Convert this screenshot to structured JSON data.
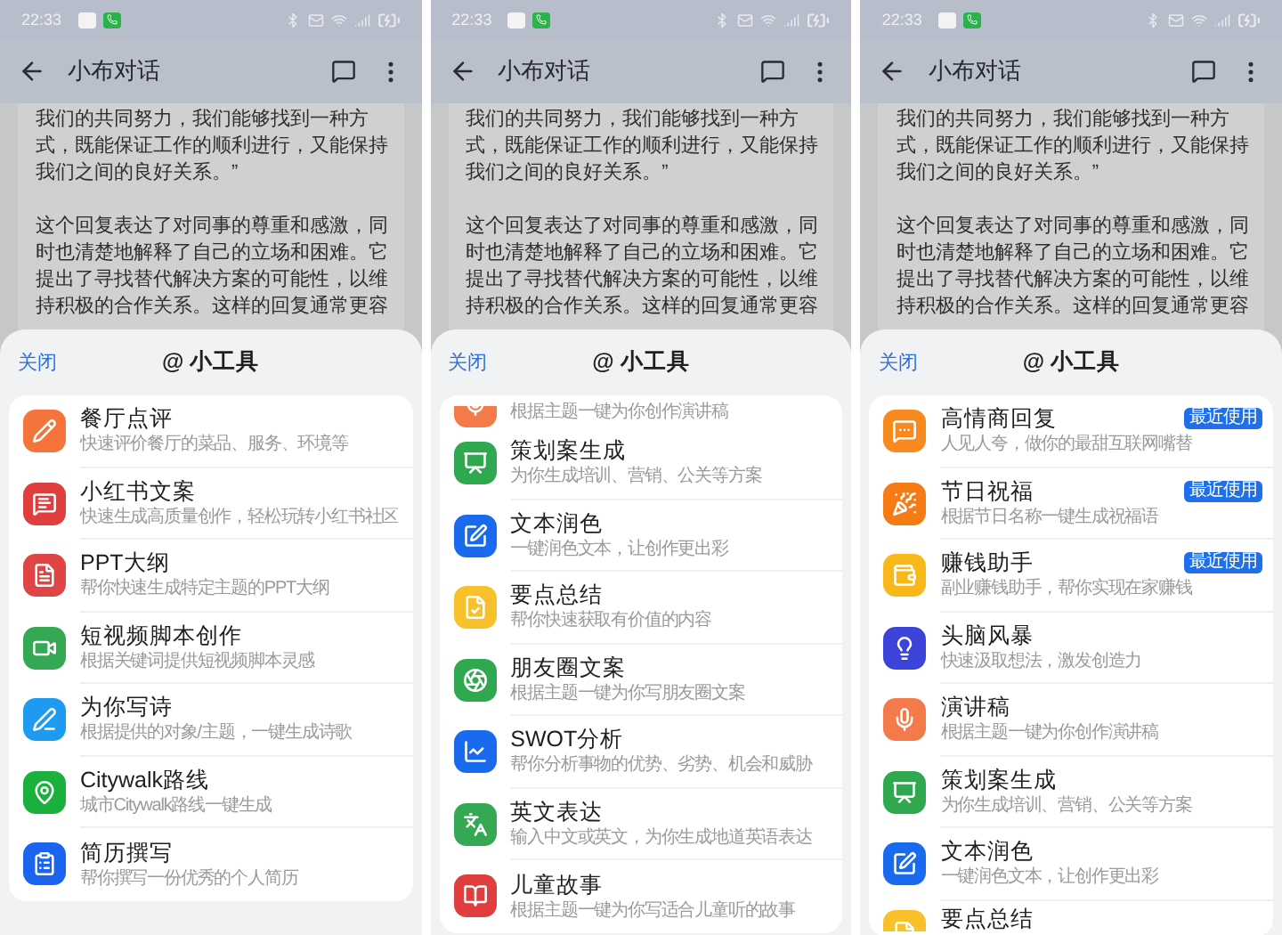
{
  "panels": [
    {
      "status_bar": {
        "time": "22:33"
      },
      "header": {
        "title": "小布对话"
      },
      "message": {
        "paragraphs": [
          "我们的共同努力，我们能够找到一种方式，既能保证工作的顺利进行，又能保持我们之间的良好关系。”",
          "这个回复表达了对同事的尊重和感激，同时也清楚地解释了自己的立场和困难。它提出了寻找替代解决方案的可能性，以维持积极的合作关系。这样的回复通常更容"
        ]
      },
      "sheet": {
        "close": "关闭",
        "title": "@ 小工具",
        "tools": [
          {
            "kind": "full",
            "name": "餐厅点评",
            "description": "快速评价餐厅的菜品、服务、环境等",
            "color": "#f4743b"
          },
          {
            "kind": "full",
            "name": "小红书文案",
            "description": "快速生成高质量创作，轻松玩转小红书社区",
            "color": "#e03e3e"
          },
          {
            "kind": "full",
            "name": "PPT大纲",
            "description": "帮你快速生成特定主题的PPT大纲",
            "color": "#e04545"
          },
          {
            "kind": "full",
            "name": "短视频脚本创作",
            "description": "根据关键词提供短视频脚本灵感",
            "color": "#34a853"
          },
          {
            "kind": "full",
            "name": "为你写诗",
            "description": "根据提供的对象/主题，一键生成诗歌",
            "color": "#1e9bf0"
          },
          {
            "kind": "full",
            "name": "Citywalk路线",
            "description": "城市Citywalk路线一键生成",
            "color": "#1bb03c"
          },
          {
            "kind": "full",
            "name": "简历撰写",
            "description": "帮你撰写一份优秀的个人简历",
            "color": "#1a64f0"
          }
        ]
      }
    },
    {
      "status_bar": {
        "time": "22:33"
      },
      "header": {
        "title": "小布对话"
      },
      "message": {
        "paragraphs": [
          "我们的共同努力，我们能够找到一种方式，既能保证工作的顺利进行，又能保持我们之间的良好关系。”",
          "这个回复表达了对同事的尊重和感激，同时也清楚地解释了自己的立场和困难。它提出了寻找替代解决方案的可能性，以维持积极的合作关系。这样的回复通常更容"
        ]
      },
      "sheet": {
        "close": "关闭",
        "title": "@ 小工具",
        "tools": [
          {
            "kind": "cut_top",
            "description": "根据主题一键为你创作演讲稿",
            "color": "#f47a4a"
          },
          {
            "kind": "full",
            "name": "策划案生成",
            "description": "为你生成培训、营销、公关等方案",
            "color": "#2fa84f"
          },
          {
            "kind": "full",
            "name": "文本润色",
            "description": "一键润色文本，让创作更出彩",
            "color": "#1a6af0"
          },
          {
            "kind": "full",
            "name": "要点总结",
            "description": "帮你快速获取有价值的内容",
            "color": "#f8c02a"
          },
          {
            "kind": "full",
            "name": "朋友圈文案",
            "description": "根据主题一键为你写朋友圈文案",
            "color": "#2fa84f"
          },
          {
            "kind": "full",
            "name": "SWOT分析",
            "description": "帮你分析事物的优势、劣势、机会和威胁",
            "color": "#1a6af0"
          },
          {
            "kind": "full",
            "name": "英文表达",
            "description": "输入中文或英文，为你生成地道英语表达",
            "color": "#34a853"
          },
          {
            "kind": "full",
            "name": "儿童故事",
            "description": "根据主题一键为你写适合儿童听的故事",
            "color": "#e03e3e"
          }
        ]
      }
    },
    {
      "status_bar": {
        "time": "22:33"
      },
      "header": {
        "title": "小布对话"
      },
      "message": {
        "paragraphs": [
          "我们的共同努力，我们能够找到一种方式，既能保证工作的顺利进行，又能保持我们之间的良好关系。”",
          "这个回复表达了对同事的尊重和感激，同时也清楚地解释了自己的立场和困难。它提出了寻找替代解决方案的可能性，以维持积极的合作关系。这样的回复通常更容"
        ]
      },
      "sheet": {
        "close": "关闭",
        "title": "@ 小工具",
        "tools": [
          {
            "kind": "full",
            "name": "高情商回复",
            "description": "人见人夸，做你的最甜互联网嘴替",
            "color": "#f7891f",
            "badge": "最近使用"
          },
          {
            "kind": "full",
            "name": "节日祝福",
            "description": "根据节日名称一键生成祝福语",
            "color": "#f77b14",
            "badge": "最近使用"
          },
          {
            "kind": "full",
            "name": "赚钱助手",
            "description": "副业赚钱助手，帮你实现在家赚钱",
            "color": "#f9b81a",
            "badge": "最近使用"
          },
          {
            "kind": "full",
            "name": "头脑风暴",
            "description": "快速汲取想法，激发创造力",
            "color": "#3c43d8"
          },
          {
            "kind": "full",
            "name": "演讲稿",
            "description": "根据主题一键为你创作演讲稿",
            "color": "#f47a4a"
          },
          {
            "kind": "full",
            "name": "策划案生成",
            "description": "为你生成培训、营销、公关等方案",
            "color": "#2fa84f"
          },
          {
            "kind": "full",
            "name": "文本润色",
            "description": "一键润色文本，让创作更出彩",
            "color": "#1a6af0"
          },
          {
            "kind": "cut_bottom",
            "name": "要点总结",
            "color": "#f8c02a"
          }
        ]
      }
    }
  ]
}
